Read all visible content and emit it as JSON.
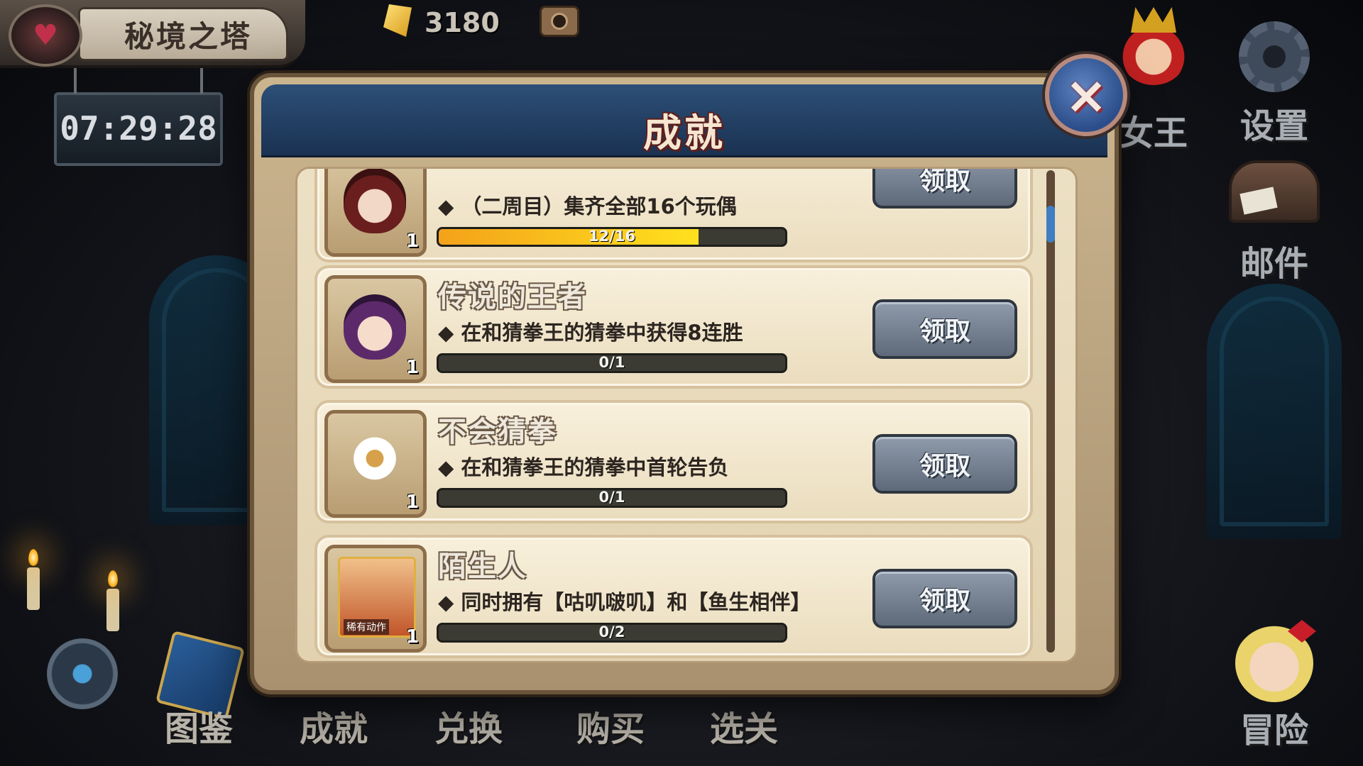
{
  "location": {
    "title": "秘境之塔"
  },
  "timer": "07:29:28",
  "currency": {
    "gems": "3180"
  },
  "right_menu": [
    {
      "label": "女王",
      "icon": "queen-crown-icon"
    },
    {
      "label": "设置",
      "icon": "gear-icon"
    },
    {
      "label": "邮件",
      "icon": "mailbox-icon"
    },
    {
      "label": "冒险",
      "icon": "adventure-character-icon"
    }
  ],
  "bottom_menu": [
    {
      "label": "图鉴"
    },
    {
      "label": "成就"
    },
    {
      "label": "兑换"
    },
    {
      "label": "购买"
    },
    {
      "label": "选关"
    }
  ],
  "modal": {
    "title": "成就",
    "close_icon": "×",
    "achievements": [
      {
        "name": "",
        "description": "◆ （二周目）集齐全部16个玩偶",
        "progress_text": "12/16",
        "progress": 0.75,
        "count": "1",
        "button": "领取"
      },
      {
        "name": "传说的王者",
        "description": "◆ 在和猜拳王的猜拳中获得8连胜",
        "progress_text": "0/1",
        "progress": 0,
        "count": "1",
        "button": "领取"
      },
      {
        "name": "不会猜拳",
        "description": "◆ 在和猜拳王的猜拳中首轮告负",
        "progress_text": "0/1",
        "progress": 0,
        "count": "1",
        "button": "领取"
      },
      {
        "name": "陌生人",
        "description": "◆ 同时拥有【咕叽啵叽】和【鱼生相伴】",
        "progress_text": "0/2",
        "progress": 0,
        "count": "1",
        "button": "领取",
        "badge": "稀有动作"
      }
    ]
  },
  "colors": {
    "progress_fill": "#ffd21e",
    "header_blue": "#2d4f77",
    "claim_button": "#7a8696"
  }
}
